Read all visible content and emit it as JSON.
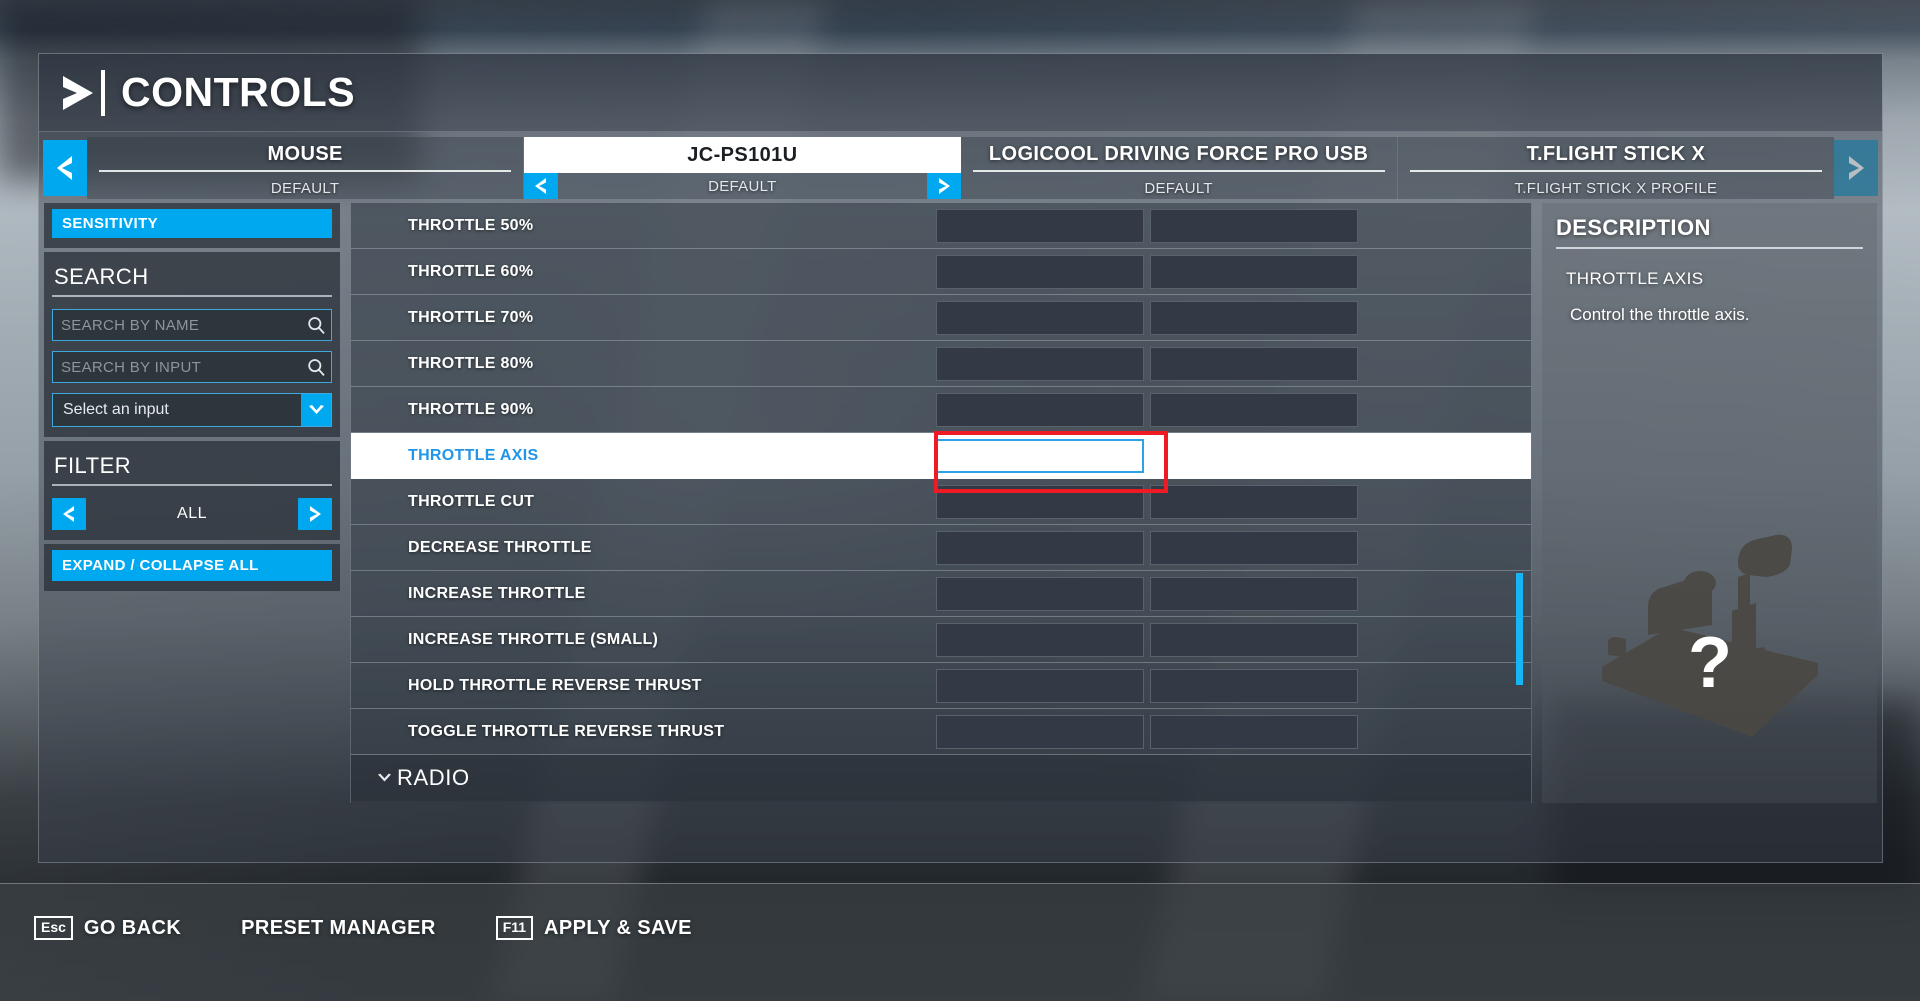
{
  "header": {
    "title": "CONTROLS",
    "chevron_icon": "chevron-right-icon"
  },
  "device_tabs": {
    "prev_icon": "chevron-left-icon",
    "next_icon": "chevron-right-icon",
    "items": [
      {
        "name": "MOUSE",
        "profile": "DEFAULT",
        "selected": false
      },
      {
        "name": "JC-PS101U",
        "profile": "DEFAULT",
        "selected": true
      },
      {
        "name": "LOGICOOL DRIVING FORCE PRO USB",
        "profile": "DEFAULT",
        "selected": false
      },
      {
        "name": "T.FLIGHT STICK X",
        "profile": "T.FLIGHT STICK X PROFILE",
        "selected": false
      }
    ]
  },
  "sidebar": {
    "sensitivity_label": "SENSITIVITY",
    "search_title": "SEARCH",
    "search_by_name": {
      "value": "",
      "placeholder": "SEARCH BY NAME",
      "icon": "search-icon"
    },
    "search_by_input": {
      "value": "",
      "placeholder": "SEARCH BY INPUT",
      "icon": "search-icon"
    },
    "input_select": {
      "value": "Select an input",
      "caret_icon": "chevron-down-icon"
    },
    "filter_title": "FILTER",
    "filter_value": "ALL",
    "filter_prev_icon": "chevron-left-icon",
    "filter_next_icon": "chevron-right-icon",
    "expand_collapse_label": "EXPAND / COLLAPSE ALL"
  },
  "binding_list": {
    "rows": [
      {
        "label": "THROTTLE 50%",
        "binding_1": "",
        "binding_2": "",
        "selected": false
      },
      {
        "label": "THROTTLE 60%",
        "binding_1": "",
        "binding_2": "",
        "selected": false
      },
      {
        "label": "THROTTLE 70%",
        "binding_1": "",
        "binding_2": "",
        "selected": false
      },
      {
        "label": "THROTTLE 80%",
        "binding_1": "",
        "binding_2": "",
        "selected": false
      },
      {
        "label": "THROTTLE 90%",
        "binding_1": "",
        "binding_2": "",
        "selected": false
      },
      {
        "label": "THROTTLE AXIS",
        "binding_1": "",
        "binding_2": "",
        "selected": true
      },
      {
        "label": "THROTTLE CUT",
        "binding_1": "",
        "binding_2": "",
        "selected": false
      },
      {
        "label": "DECREASE THROTTLE",
        "binding_1": "",
        "binding_2": "",
        "selected": false
      },
      {
        "label": "INCREASE THROTTLE",
        "binding_1": "",
        "binding_2": "",
        "selected": false
      },
      {
        "label": "INCREASE THROTTLE (SMALL)",
        "binding_1": "",
        "binding_2": "",
        "selected": false
      },
      {
        "label": "HOLD THROTTLE REVERSE THRUST",
        "binding_1": "",
        "binding_2": "",
        "selected": false
      },
      {
        "label": "TOGGLE THROTTLE REVERSE THRUST",
        "binding_1": "",
        "binding_2": "",
        "selected": false
      }
    ],
    "group_header": {
      "label": "RADIO",
      "chevron_icon": "chevron-down-icon"
    },
    "scrollbar": {
      "icon": "vertical-scrollbar"
    }
  },
  "description": {
    "title": "DESCRIPTION",
    "subject": "THROTTLE AXIS",
    "text": "Control the throttle axis.",
    "device_art_icon": "joystick-silhouette-icon",
    "unknown_glyph": "?"
  },
  "action_bar": {
    "items": [
      {
        "key": "Esc",
        "label": "GO BACK"
      },
      {
        "key": "",
        "label": "PRESET MANAGER"
      },
      {
        "key": "F11",
        "label": "APPLY & SAVE"
      }
    ]
  },
  "colors": {
    "accent": "#00a8f0",
    "accent_bright": "#18b5f5",
    "selected_text": "#2196e8",
    "annotation": "#ee1b24",
    "panel_text": "#ffffff"
  }
}
